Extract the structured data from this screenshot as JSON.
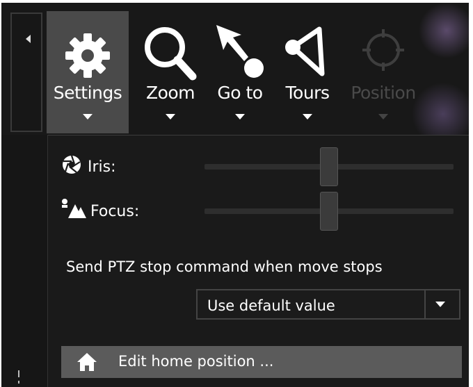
{
  "toolbar": {
    "items": [
      {
        "label": "Settings",
        "icon": "gear-icon",
        "state": "active"
      },
      {
        "label": "Zoom",
        "icon": "magnifier-icon",
        "state": "normal"
      },
      {
        "label": "Go to",
        "icon": "goto-arrow-icon",
        "state": "normal"
      },
      {
        "label": "Tours",
        "icon": "tours-icon",
        "state": "normal"
      },
      {
        "label": "Position",
        "icon": "crosshair-icon",
        "state": "disabled"
      }
    ]
  },
  "settings": {
    "iris": {
      "label": "Iris:",
      "icon": "aperture-icon",
      "value_fraction": 0.5
    },
    "focus": {
      "label": "Focus:",
      "icon": "focus-landscape-icon",
      "value_fraction": 0.5
    },
    "ptz_stop": {
      "label": "Send PTZ stop command when move stops",
      "selected": "Use default value"
    },
    "home": {
      "label": "Edit home position ...",
      "icon": "home-icon"
    }
  },
  "colors": {
    "panel_bg": "#1a1a1a",
    "active_tool_bg": "#4a4a4a",
    "button_bg": "#5b5b5b",
    "text": "#ffffff",
    "disabled_text": "#4a4a4a"
  }
}
